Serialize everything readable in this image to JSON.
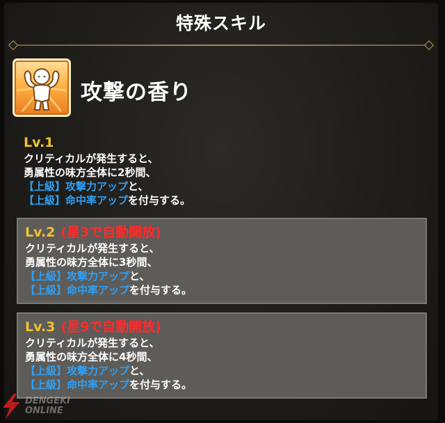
{
  "header": {
    "title": "特殊スキル"
  },
  "skill": {
    "name": "攻撃の香り",
    "icon": "flexing-figure-icon"
  },
  "levels": [
    {
      "label": "Lv.1",
      "note": "",
      "locked": false,
      "lines": [
        "クリティカルが発生すると、",
        "勇属性の味方全体に2秒間、"
      ],
      "buffs": [
        {
          "name": "【上級】攻撃力アップ",
          "suffix": "と、"
        },
        {
          "name": "【上級】命中率アップ",
          "suffix": "を付与する。"
        }
      ]
    },
    {
      "label": "Lv.2",
      "note": "(星3で自動開放)",
      "locked": true,
      "lines": [
        "クリティカルが発生すると、",
        "勇属性の味方全体に3秒間、"
      ],
      "buffs": [
        {
          "name": "【上級】攻撃力アップ",
          "suffix": "と、"
        },
        {
          "name": "【上級】命中率アップ",
          "suffix": "を付与する。"
        }
      ]
    },
    {
      "label": "Lv.3",
      "note": "(星9で自動開放)",
      "locked": true,
      "lines": [
        "クリティカルが発生すると、",
        "勇属性の味方全体に4秒間、"
      ],
      "buffs": [
        {
          "name": "【上級】攻撃力アップ",
          "suffix": "と、"
        },
        {
          "name": "【上級】命中率アップ",
          "suffix": "を付与する。"
        }
      ]
    }
  ],
  "colors": {
    "level_label": "#f2c230",
    "unlock_note": "#ff2b2b",
    "buff_text": "#2f9ff4",
    "locked_panel": "#5d5c59"
  },
  "watermark": {
    "line1": "DENGEKI",
    "line2": "ONLINE"
  }
}
